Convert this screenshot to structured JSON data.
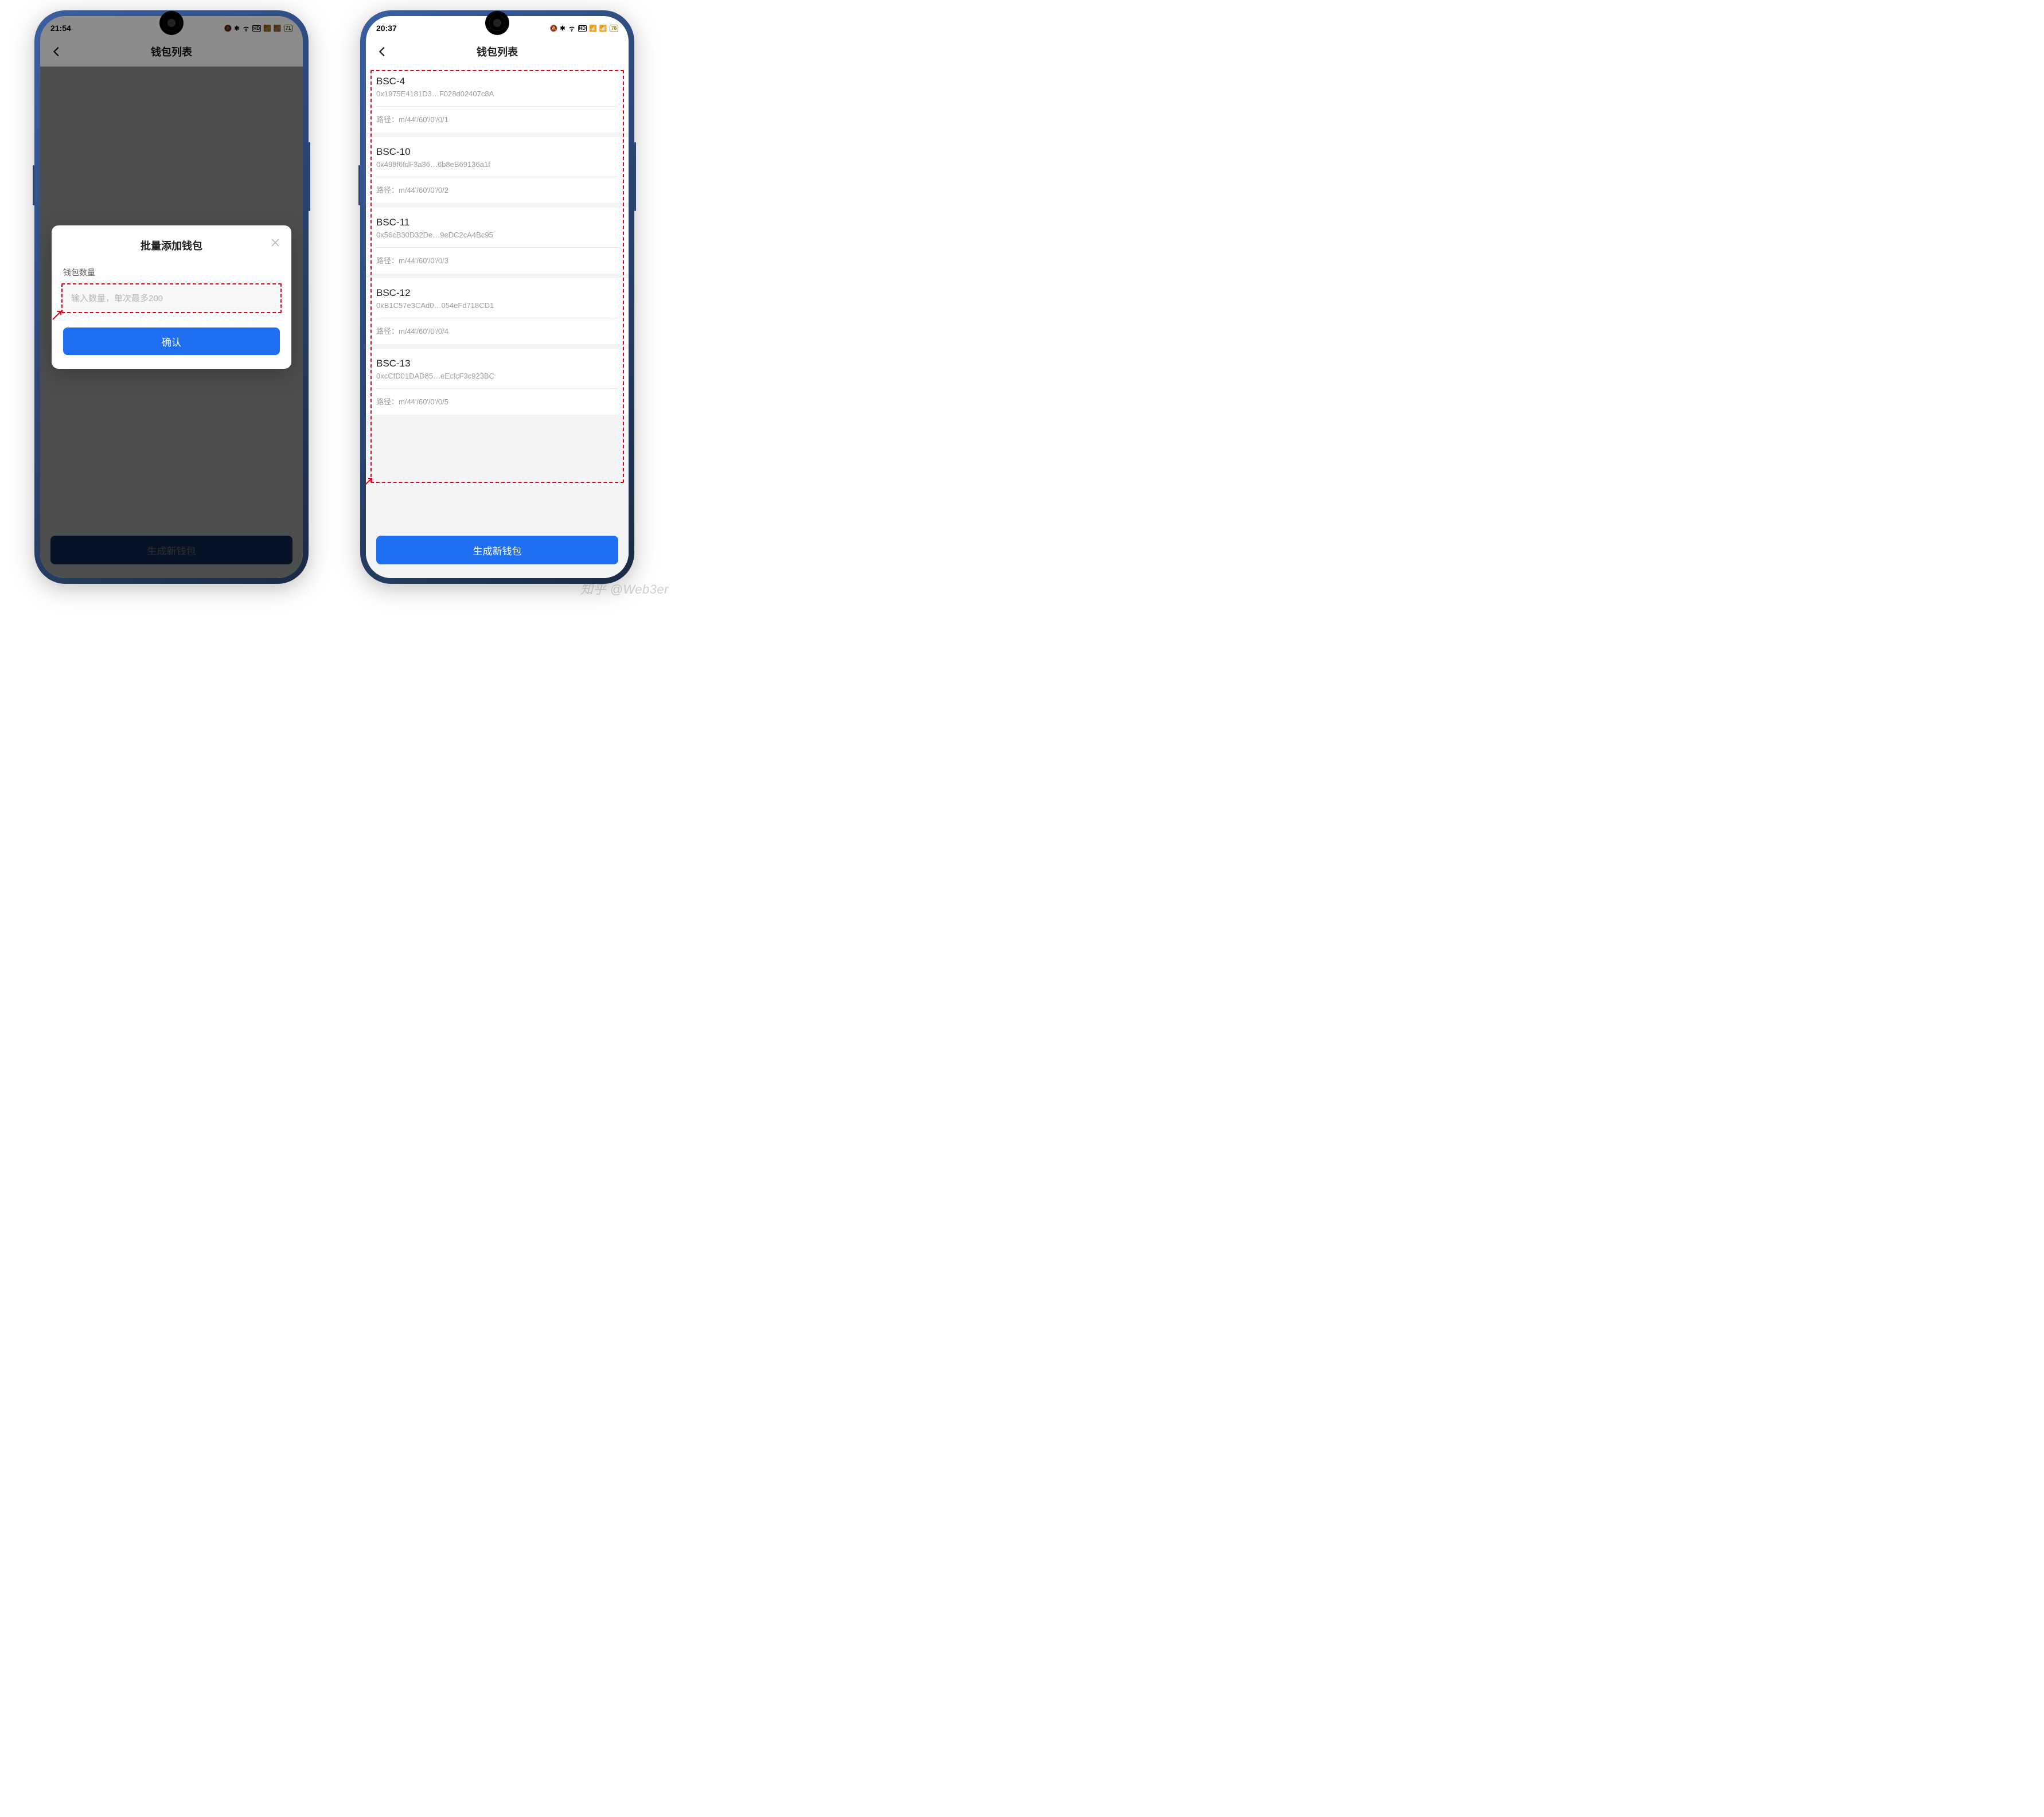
{
  "watermark": "知乎 @Web3er",
  "phone1": {
    "status": {
      "time": "21:54",
      "battery": "71"
    },
    "header": {
      "title": "钱包列表"
    },
    "bottom_btn": "生成新钱包",
    "modal": {
      "title": "批量添加钱包",
      "label": "钱包数量",
      "placeholder": "输入数量，单次最多200",
      "confirm": "确认"
    }
  },
  "phone2": {
    "status": {
      "time": "20:37",
      "battery": "78"
    },
    "header": {
      "title": "钱包列表"
    },
    "bottom_btn": "生成新钱包",
    "path_prefix": "路径：",
    "wallets": [
      {
        "name": "BSC-4",
        "addr": "0x1975E4181D3…F028d02407c8A",
        "path": "m/44'/60'/0'/0/1"
      },
      {
        "name": "BSC-10",
        "addr": "0x498f6fdF3a36…6b8eB69136a1f",
        "path": "m/44'/60'/0'/0/2"
      },
      {
        "name": "BSC-11",
        "addr": "0x56cB30D32De…9eDC2cA4Bc95",
        "path": "m/44'/60'/0'/0/3"
      },
      {
        "name": "BSC-12",
        "addr": "0xB1C57e3CAd0…054eFd718CD1",
        "path": "m/44'/60'/0'/0/4"
      },
      {
        "name": "BSC-13",
        "addr": "0xcCfD01DAD85…eEcfcF3c923BC",
        "path": "m/44'/60'/0'/0/5"
      }
    ]
  }
}
